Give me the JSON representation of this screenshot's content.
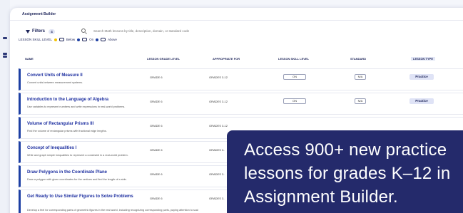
{
  "window": {
    "title": "Assignment Builder"
  },
  "filters": {
    "label": "Filters",
    "count": "4",
    "search_placeholder": "Search Math lessons by title, description, domain, or standard code"
  },
  "skill_legend": {
    "label": "LESSON SKILL LEVEL",
    "below": "Below",
    "on": "On",
    "above": "Above"
  },
  "columns": {
    "name": "NAME",
    "grade": "LESSON GRADE LEVEL",
    "appropriate": "APPROPRIATE FOR",
    "skill": "LESSON SKILL LEVEL",
    "standard": "STANDARD",
    "type": "LESSON TYPE"
  },
  "lessons": [
    {
      "title": "Convert Units of Measure II",
      "desc": "Convert units between measurement systems.",
      "grade": "GRADE 6",
      "appropriate": "GRADES 3-12",
      "skill": "ON",
      "standard": "N/A",
      "type": "Practice"
    },
    {
      "title": "Introduction to the Language of Algebra",
      "desc": "Use variables to represent numbers and write expressions in real-world problems.",
      "grade": "GRADE 6",
      "appropriate": "GRADES 3-12",
      "skill": "ON",
      "standard": "N/A",
      "type": "Practice"
    },
    {
      "title": "Volume of Rectangular Prisms III",
      "desc": "Find the volume of rectangular prisms with fractional edge lengths.",
      "grade": "GRADE 6",
      "appropriate": "GRADES 3-12"
    },
    {
      "title": "Concept of Inequalities I",
      "desc": "Write and graph simple inequalities to represent a constraint in a real-world problem.",
      "grade": "GRADE 6",
      "appropriate": "GRADES 3-"
    },
    {
      "title": "Draw Polygons in the Coordinate Plane",
      "desc": "Draw a polygon with given coordinates for the vertices and find the length of a side.",
      "grade": "GRADE 6",
      "appropriate": "GRADES 3-"
    },
    {
      "title": "Get Ready to Use Similar Figures to Solve Problems",
      "desc": "Develop a feel for corresponding parts of geometric figures in the real world, including recognizing corresponding parts, paying attention to scal",
      "grade": "GRADE 6",
      "appropriate": "GRADES 3-"
    }
  ],
  "promo": {
    "line1": "Access 900+ new practice",
    "line2": "lessons for grades K–12 in",
    "line3": "Assignment Builder."
  }
}
